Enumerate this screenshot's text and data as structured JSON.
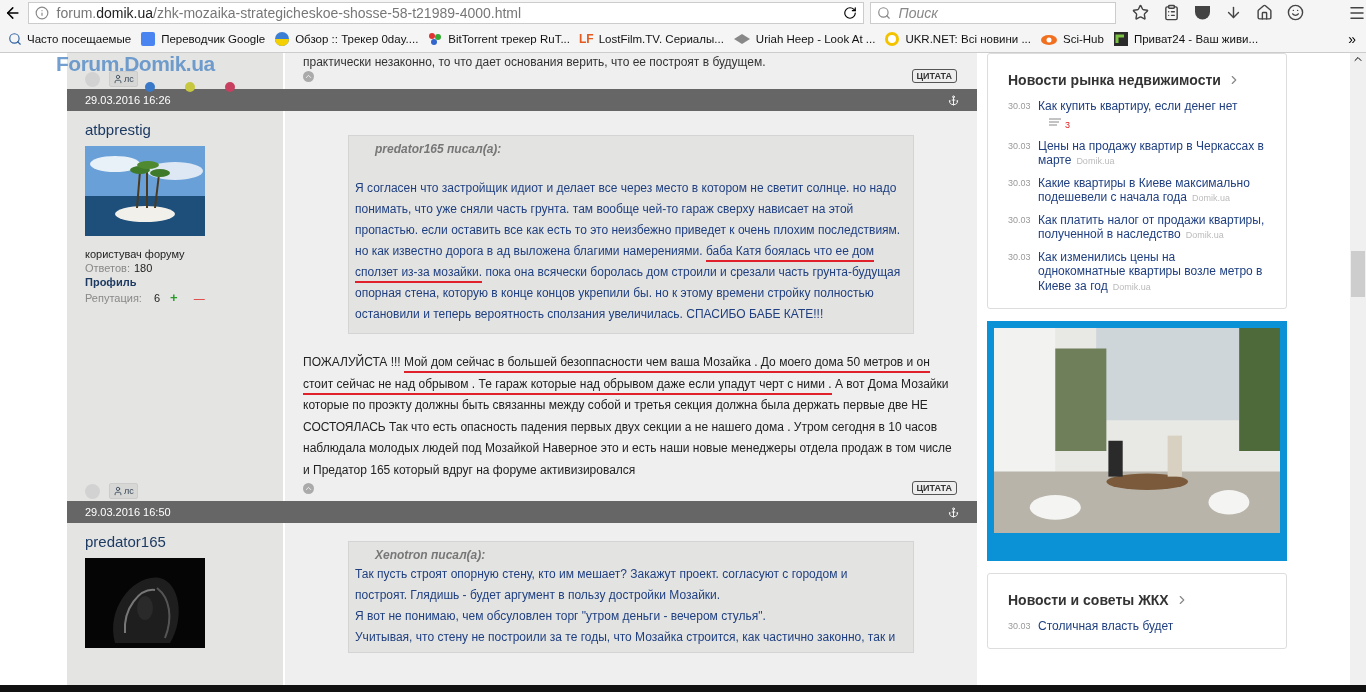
{
  "browser": {
    "url": {
      "prefix": "forum.",
      "domain": "domik.ua",
      "path": "/zhk-mozaika-strategicheskoe-shosse-58-t21989-4000.html"
    },
    "search": {
      "placeholder": "Поиск"
    }
  },
  "bookmarks": [
    {
      "label": "Часто посещаемые"
    },
    {
      "label": "Переводчик Google"
    },
    {
      "label": "Обзор :: Трекер 0day...."
    },
    {
      "label": "BitTorrent трекер RuT..."
    },
    {
      "logo_text": "LF",
      "label": "LostFilm.TV. Сериалы..."
    },
    {
      "label": "Uriah Heep - Look At ..."
    },
    {
      "label": "UKR.NET: Всі новини ..."
    },
    {
      "label": "Sci-Hub"
    },
    {
      "label": "Приват24 - Ваш живи..."
    }
  ],
  "bookmarks_overflow": "»",
  "site_logo": "Forum.Domik.ua",
  "previous_post": {
    "text": "практически незаконно, то что дает основания верить, что ее построят в будущем.",
    "pm_label": "лс",
    "quote_button": "ЦИТАТА"
  },
  "posts": [
    {
      "date": "29.03.2016 16:26",
      "author": "atbprestig",
      "role": "користувач форуму",
      "answers_label": "Ответов:",
      "answers": "180",
      "profile": "Профиль",
      "reputation_label": "Репутация:",
      "reputation": "6",
      "rep_plus": "+",
      "rep_minus": "—",
      "quote": {
        "author": "predator165 писал(а):",
        "lines": [
          [
            {
              "text": "Я согласен что застройщик идиот и делает все через место в котором не светит солнце. но надо понимать, что уже сняли часть грунта. там вообще чей-то гараж сверху нависает на этой пропастью. если оставить все как есть то это неизбежно приведет к очень плохим последствиям. но как известно дорога в ад выложена благими намерениями. ",
              "underlined": false
            },
            {
              "text": "баба Катя боялась что ее дом сползет из-за мозайки.",
              "underlined": true
            },
            {
              "text": " пока она всячески боролась дом строили и срезали часть грунта-будущая опорная стена, которую в конце концов укрепили бы. но к этому времени стройку полностью остановили и теперь вероятность сползания увеличилась. СПАСИБО БАБЕ КАТЕ!!!",
              "underlined": false
            }
          ]
        ]
      },
      "body": [
        {
          "text": "ПОЖАЛУЙСТА !!! ",
          "underlined": false
        },
        {
          "text": "Мой дом сейчас в большей безоппасности чем ваша Мозайка . До моего дома 50 метров и он стоит сейчас не над обрывом . Те гараж которые над обрывом даже если упадут черт с ними .",
          "underlined": true
        },
        {
          "text": " А вот Дома Мозайки которые по проэкту должны быть связанны между собой и третья секция должна была держать первые две НЕ СОСТОЯЛАСЬ Так что есть опасность падения первых двух секции а не нашего дома . Утром сегодня в 10 часов наблюдала молодых людей под Мозайкой Наверное это и есть наши новые менеджеры отдела продаж в том числе и Предатор 165 который вдруг на форуме активизировался",
          "underlined": false
        }
      ],
      "pm_label": "лс",
      "quote_button": "ЦИТАТА"
    },
    {
      "date": "29.03.2016 16:50",
      "author": "predator165",
      "quote": {
        "author": "Xenotron писал(а):",
        "lines": [
          [
            {
              "text": "Так пусть строят опорную стену, кто им мешает? Закажут проект. согласуют с городом и"
            }
          ],
          [
            {
              "text": "построят. Глядишь - будет аргумент в пользу достройки Мозайки."
            }
          ],
          [
            {
              "text": "Я вот не понимаю, чем обсуловлен торг \"утром деньги - вечером стулья\"."
            }
          ],
          [
            {
              "text": "Учитывая, что стену не построили за те годы, что Мозайка строится, как частично законно, так и"
            }
          ]
        ]
      }
    }
  ],
  "sidebar": {
    "news": {
      "title": "Новости рынка недвижимости",
      "items": [
        {
          "date": "30.03",
          "title": "Как купить квартиру, если денег нет",
          "comments": "3"
        },
        {
          "date": "30.03",
          "title": "Цены на продажу квартир в Черкассах в марте",
          "source": "Domik.ua"
        },
        {
          "date": "30.03",
          "title": "Какие квартиры в Киеве максимально подешевели с начала года",
          "source": "Domik.ua"
        },
        {
          "date": "30.03",
          "title": "Как платить налог от продажи квартиры, полученной в наследство",
          "source": "Domik.ua"
        },
        {
          "date": "30.03",
          "title": "Как изменились цены на однокомнатные квартиры возле метро в Киеве за год",
          "source": "Domik.ua"
        }
      ]
    },
    "housing": {
      "title": "Новости и советы ЖКХ",
      "items": [
        {
          "date": "30.03",
          "title": "Столичная власть будет"
        }
      ]
    }
  }
}
